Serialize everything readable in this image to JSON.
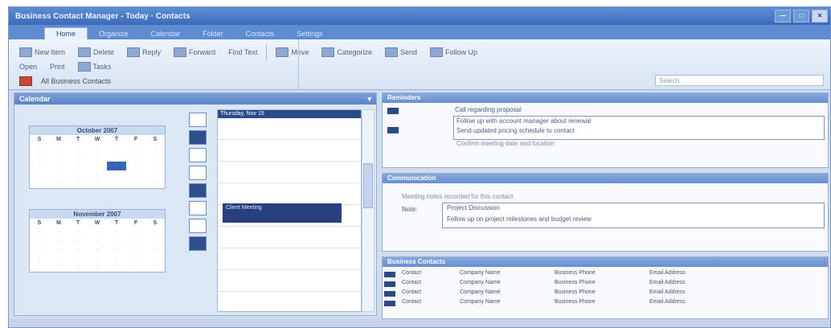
{
  "app": {
    "title": "Business Contact Manager - Today · Contacts"
  },
  "ribbon": {
    "tabs": [
      "Home",
      "Organize",
      "Calendar",
      "Folder",
      "Contacts",
      "Settings"
    ],
    "row1": [
      "New Item",
      "Delete",
      "Reply",
      "Forward",
      "Find Text",
      "Move",
      "Categorize",
      "Send",
      "Follow Up"
    ],
    "row2": [
      "Open",
      "Print",
      "Tasks"
    ],
    "breadcrumb": "All Business Contacts",
    "search_placeholder": "Search"
  },
  "left_pane": {
    "title": "Calendar",
    "month1": {
      "name": "October 2007",
      "dow": [
        "S",
        "M",
        "T",
        "W",
        "T",
        "F",
        "S"
      ]
    },
    "month2": {
      "name": "November 2007",
      "dow": [
        "S",
        "M",
        "T",
        "W",
        "T",
        "F",
        "S"
      ]
    },
    "schedule_header": "Thursday, Nov 15",
    "appointment": "Client Meeting"
  },
  "panel1": {
    "title": "Reminders",
    "line1": "Call regarding proposal",
    "line2": "Follow up with account manager about renewal",
    "line3": "Send updated pricing schedule to contact",
    "line4": "Confirm meeting date and location"
  },
  "panel2": {
    "title": "Communication",
    "line1": "Meeting notes recorded for this contact",
    "label": "Note:",
    "line2": "Project Discussion",
    "line3": "Follow up on project milestones and budget review"
  },
  "panel3": {
    "title": "Business Contacts",
    "rows": [
      [
        "Contact",
        "Company Name",
        "Business Phone",
        "Email Address"
      ],
      [
        "Contact",
        "Company Name",
        "Business Phone",
        "Email Address"
      ],
      [
        "Contact",
        "Company Name",
        "Business Phone",
        "Email Address"
      ],
      [
        "Contact",
        "Company Name",
        "Business Phone",
        "Email Address"
      ]
    ]
  }
}
